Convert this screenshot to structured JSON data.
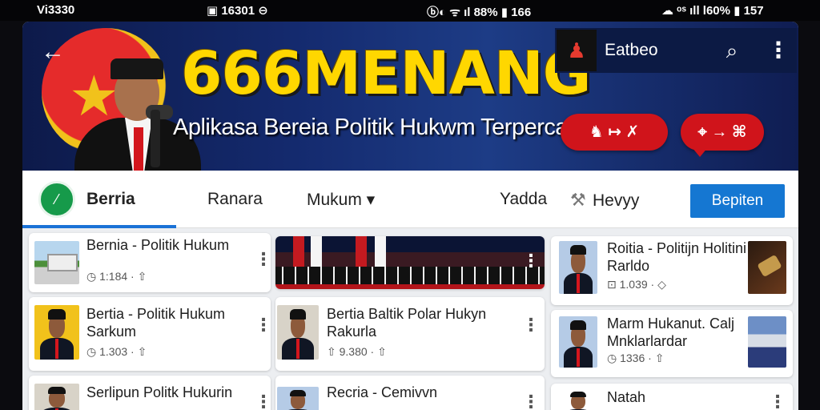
{
  "status_bar": {
    "time": "Vi3330",
    "middle": "▣ 16301 ⊖",
    "network_left": "ⓑ◐ ᯤ ıl 88% ▮ 166",
    "network_right": "☁ ᵒˢ ıll l60% ▮ 157"
  },
  "banner": {
    "back_icon": "arrow-left-icon",
    "title": "666MENANG",
    "subtitle": "Aplikasa Bereia Politik Hukwm Terpercaya",
    "pill_1": "♞ ↦ ✗",
    "pill_2": "⌖ → ⌘",
    "app_name": "Eatbeo",
    "colors": {
      "title": "#ffd700",
      "banner_bg": "#142a6e",
      "pill": "#d0141b"
    }
  },
  "nav": {
    "logo_text": "⁄",
    "tabs": [
      {
        "label": "Berria",
        "active": true
      },
      {
        "label": "Ranara",
        "active": false
      },
      {
        "label": "Mukum ▾",
        "active": false
      },
      {
        "label": "Yadda",
        "active": false
      },
      {
        "label": "Hevyy",
        "active": false
      }
    ],
    "cta_label": "Bepiten",
    "colors": {
      "accent": "#1a72d6",
      "cta": "#1577d2",
      "logo": "#169a4a"
    }
  },
  "feed": {
    "cards": [
      {
        "title": "Bernia - Politik Hukum",
        "meta": "◷ 1:184 · ⇧",
        "thumb": "building"
      },
      {
        "title": "",
        "meta": "",
        "thumb": "assembly-hall"
      },
      {
        "title": "Roitia - Politijn Holitini Rarldo",
        "meta": "⊡ 1.039 · ◇",
        "thumb": "person"
      },
      {
        "title": "Bertia - Politik Hukum Sarkum",
        "meta": "◷ 1.303 · ⇧",
        "thumb": "person"
      },
      {
        "title": "Bertia Baltik Polar Hukyn Rakurla",
        "meta": "⇧ 9.380 · ⇧",
        "thumb": "person"
      },
      {
        "title": "Marm Hukanut. Calj Mnklarlardar",
        "meta": "◷ 1336 · ⇧",
        "thumb": "person"
      },
      {
        "title": "Serlipun Politk Hukurin",
        "meta": "",
        "thumb": "person"
      },
      {
        "title": "Recria - Cemivvn",
        "meta": "",
        "thumb": "person"
      },
      {
        "title": "Natah",
        "meta": "",
        "thumb": "person"
      }
    ],
    "third_col_images": [
      "gavel",
      "stage"
    ]
  }
}
